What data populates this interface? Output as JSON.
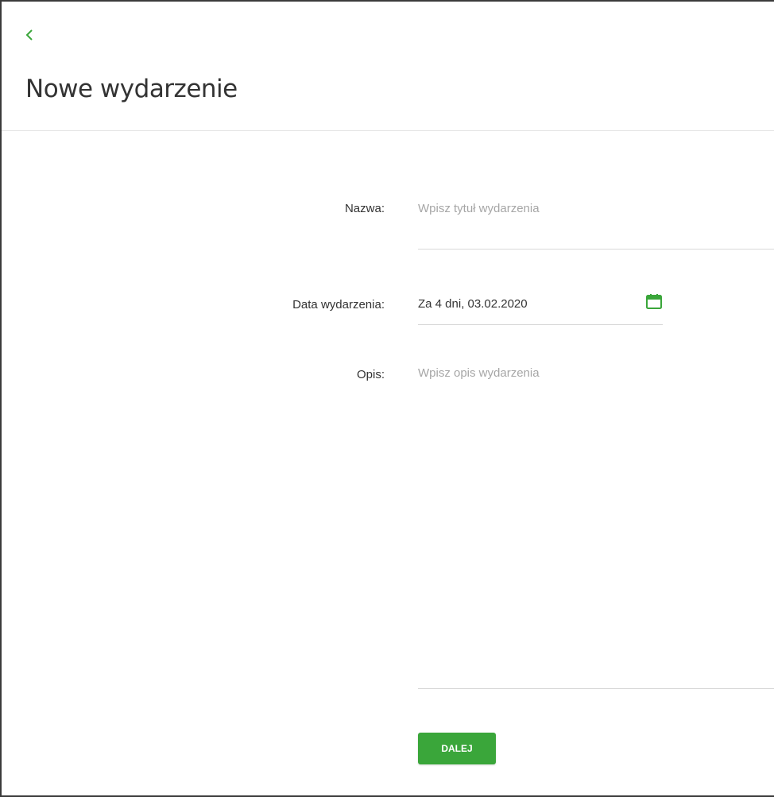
{
  "header": {
    "title": "Nowe wydarzenie",
    "back_icon": "chevron-left-icon"
  },
  "form": {
    "name": {
      "label": "Nazwa:",
      "value": "",
      "placeholder": "Wpisz tytuł wydarzenia"
    },
    "date": {
      "label": "Data wydarzenia:",
      "value": "Za 4 dni, 03.02.2020",
      "icon": "calendar-icon"
    },
    "description": {
      "label": "Opis:",
      "value": "",
      "placeholder": "Wpisz opis wydarzenia"
    }
  },
  "actions": {
    "next_label": "DALEJ"
  },
  "colors": {
    "accent": "#3aa63a",
    "text": "#333333",
    "placeholder": "#a6a6a6",
    "divider": "#e3e3e3"
  }
}
